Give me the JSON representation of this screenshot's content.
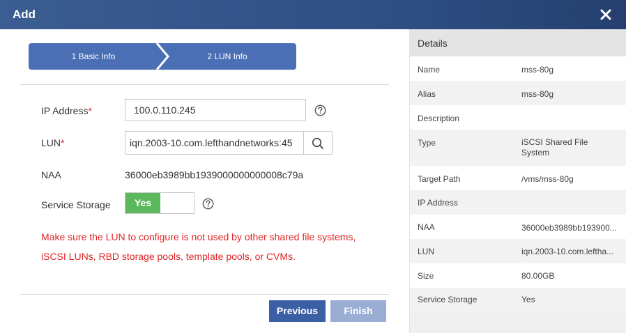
{
  "dialog": {
    "title": "Add",
    "close_icon": "close-icon"
  },
  "steps": [
    {
      "label": "1 Basic Info"
    },
    {
      "label": "2 LUN Info"
    }
  ],
  "form": {
    "ip_address": {
      "label": "IP Address",
      "required_mark": "*",
      "value": "100.0.110.245"
    },
    "lun": {
      "label": "LUN",
      "required_mark": "*",
      "value": "iqn.2003-10.com.lefthandnetworks:45"
    },
    "naa": {
      "label": "NAA",
      "value": "36000eb3989bb1939000000000008c79a"
    },
    "service_storage": {
      "label": "Service Storage",
      "toggle_label": "Yes"
    },
    "warning_line1": "Make sure the LUN to configure is not used by other shared file systems,",
    "warning_line2": "iSCSI LUNs, RBD storage pools, template pools, or CVMs."
  },
  "buttons": {
    "previous": "Previous",
    "finish": "Finish"
  },
  "details": {
    "title": "Details",
    "rows": [
      {
        "key": "Name",
        "value": "mss-80g"
      },
      {
        "key": "Alias",
        "value": "mss-80g"
      },
      {
        "key": "Description",
        "value": ""
      },
      {
        "key": "Type",
        "value": "iSCSI Shared File System"
      },
      {
        "key": "Target Path",
        "value": "/vms/mss-80g"
      },
      {
        "key": "IP Address",
        "value": ""
      },
      {
        "key": "NAA",
        "value": "36000eb3989bb193900..."
      },
      {
        "key": "LUN",
        "value": "iqn.2003-10.com.leftha..."
      },
      {
        "key": "Size",
        "value": "80.00GB"
      },
      {
        "key": "Service Storage",
        "value": "Yes"
      }
    ]
  },
  "colors": {
    "title_bar": "#2f4f85",
    "step_fill": "#4a6fb5",
    "primary_button": "#3b5fa5",
    "disabled_button": "#9aaed3",
    "toggle_on": "#5cb85c",
    "warning_text": "#e02424",
    "required_mark": "#d9232d"
  }
}
